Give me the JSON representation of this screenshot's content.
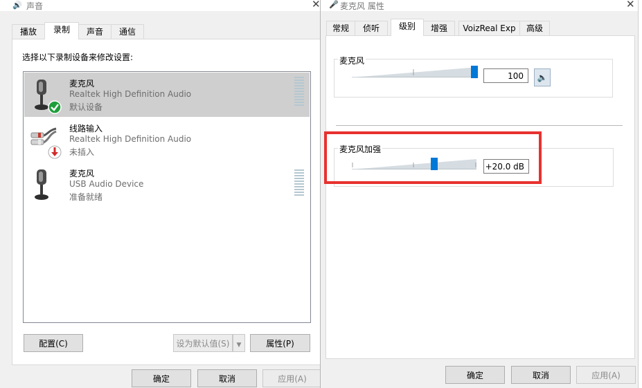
{
  "sound_dialog": {
    "title": "声音",
    "tabs": [
      "播放",
      "录制",
      "声音",
      "通信"
    ],
    "active_tab": "录制",
    "instruction": "选择以下录制设备来修改设置:",
    "devices": [
      {
        "name": "麦克风",
        "driver": "Realtek High Definition Audio",
        "status": "默认设备",
        "icon": "microphone-icon",
        "badge": "default-check-badge"
      },
      {
        "name": "线路输入",
        "driver": "Realtek High Definition Audio",
        "status": "未插入",
        "icon": "line-in-plug-icon",
        "badge": "unplugged-arrow-badge"
      },
      {
        "name": "麦克风",
        "driver": "USB Audio Device",
        "status": "准备就绪",
        "icon": "microphone-icon"
      }
    ],
    "buttons": {
      "configure": "配置(C)",
      "set_default": "设为默认值(S)",
      "properties": "属性(P)",
      "ok": "确定",
      "cancel": "取消",
      "apply": "应用(A)"
    }
  },
  "props_dialog": {
    "title": "麦克风 属性",
    "tabs": [
      "常规",
      "侦听",
      "级别",
      "增强",
      "VoizReal Exp",
      "高级"
    ],
    "active_tab": "级别",
    "mic_group": {
      "label": "麦克风",
      "value": "100",
      "level": 1.0
    },
    "boost_group": {
      "label": "麦克风加强",
      "value": "+20.0 dB",
      "level": 0.67
    },
    "buttons": {
      "ok": "确定",
      "cancel": "取消",
      "apply": "应用(A)"
    }
  },
  "colors": {
    "highlight": "#e8312f",
    "accent": "#0078d7",
    "selection": "#cfcfcf",
    "default_badge": "#1e9e3a",
    "unplugged_badge": "#d12b2b"
  }
}
